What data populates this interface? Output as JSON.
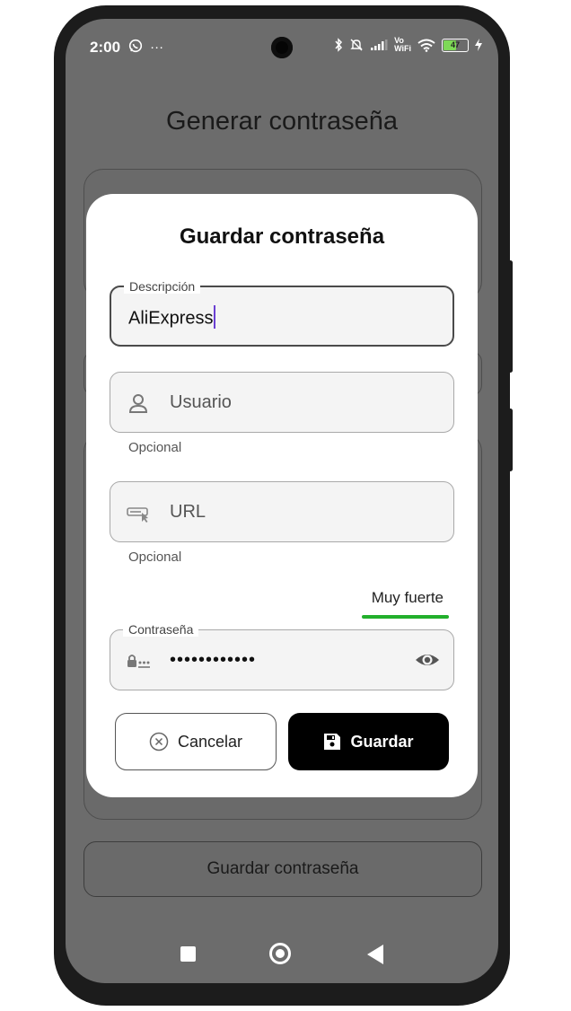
{
  "status_bar": {
    "time": "2:00",
    "left_icons": [
      "whatsapp-icon",
      "more-dots-icon"
    ],
    "right_icons": [
      "bluetooth-icon",
      "mute-icon",
      "signal-icon",
      "volte-icon",
      "wifi-icon",
      "battery-icon",
      "charging-icon"
    ],
    "vo_wifi": "Vo\nWiFi",
    "battery_level": "47"
  },
  "background": {
    "title": "Generar contraseña",
    "save_button_label": "Guardar contraseña"
  },
  "dialog": {
    "title": "Guardar contraseña",
    "description": {
      "label": "Descripción",
      "value": "AliExpress"
    },
    "user": {
      "placeholder": "Usuario",
      "helper": "Opcional",
      "icon": "person-icon"
    },
    "url": {
      "placeholder": "URL",
      "helper": "Opcional",
      "icon": "link-icon"
    },
    "strength": {
      "label": "Muy fuerte",
      "color": "#22b02c"
    },
    "password": {
      "label": "Contraseña",
      "masked_value": "••••••••••••",
      "icon": "password-icon",
      "toggle_icon": "eye-icon"
    },
    "cancel_label": "Cancelar",
    "save_label": "Guardar"
  },
  "nav_bar": {
    "icons": [
      "recents-icon",
      "home-icon",
      "back-icon"
    ]
  },
  "colors": {
    "accent": "#000000",
    "caret": "#6a3fd2",
    "scrim": "#6c6c6c"
  }
}
